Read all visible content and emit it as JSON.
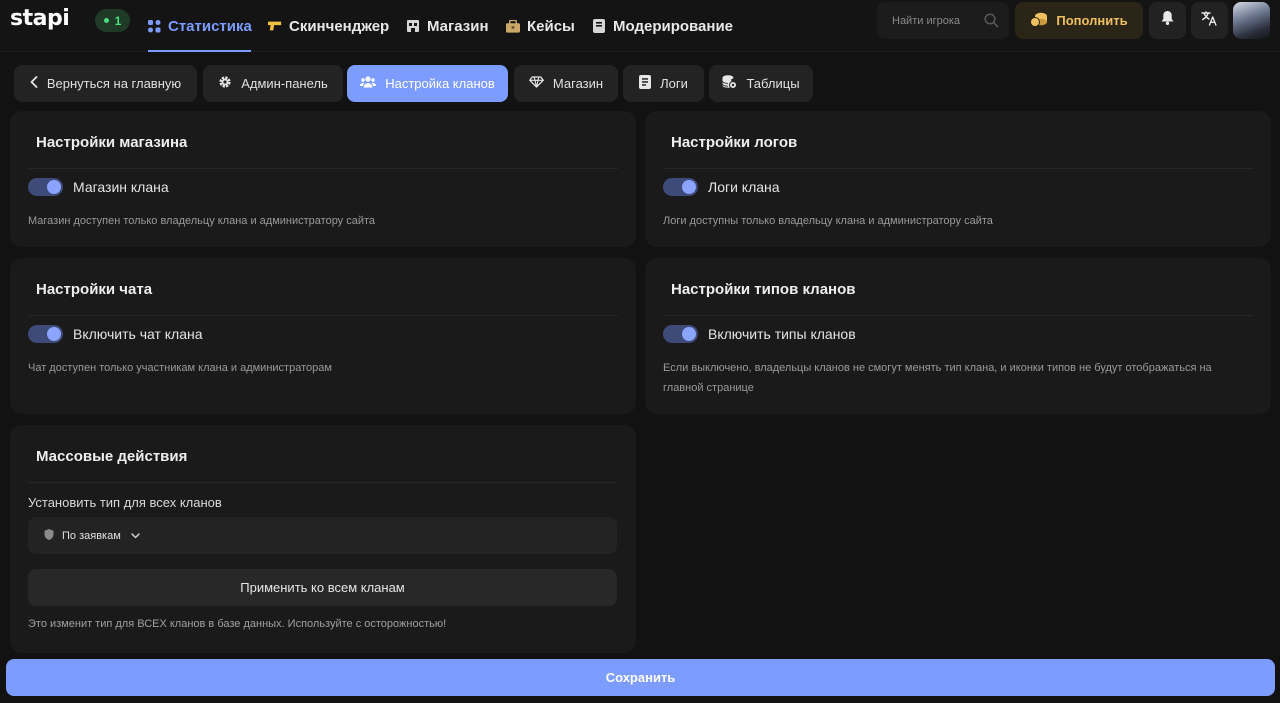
{
  "header": {
    "logo": "stapi",
    "online_count": "1",
    "nav": [
      {
        "label": "Статистика",
        "icon": "stats-icon",
        "active": true
      },
      {
        "label": "Скинченджер",
        "icon": "gun-icon",
        "active": false
      },
      {
        "label": "Магазин",
        "icon": "shop-icon",
        "active": false
      },
      {
        "label": "Кейсы",
        "icon": "case-icon",
        "active": false
      },
      {
        "label": "Модерирование",
        "icon": "book-icon",
        "active": false
      }
    ],
    "search_placeholder": "Найти игрока",
    "topup_label": "Пополнить",
    "colors": {
      "accent": "#7c9cff",
      "topup": "#f0c060",
      "online": "#4ade80"
    }
  },
  "tabs": [
    {
      "label": "Вернуться на главную",
      "icon": "chevron-left-icon",
      "active": false
    },
    {
      "label": "Админ-панель",
      "icon": "gear-icon",
      "active": false
    },
    {
      "label": "Настройка кланов",
      "icon": "users-icon",
      "active": true
    },
    {
      "label": "Магазин",
      "icon": "diamond-icon",
      "active": false
    },
    {
      "label": "Логи",
      "icon": "log-icon",
      "active": false
    },
    {
      "label": "Таблицы",
      "icon": "database-icon",
      "active": false
    }
  ],
  "cards": {
    "shop": {
      "title": "Настройки магазина",
      "toggle_label": "Магазин клана",
      "toggle_on": true,
      "description": "Магазин доступен только владельцу клана и администратору сайта"
    },
    "logs": {
      "title": "Настройки логов",
      "toggle_label": "Логи клана",
      "toggle_on": true,
      "description": "Логи доступны только владельцу клана и администратору сайта"
    },
    "chat": {
      "title": "Настройки чата",
      "toggle_label": "Включить чат клана",
      "toggle_on": true,
      "description": "Чат доступен только участникам клана и администраторам"
    },
    "types": {
      "title": "Настройки типов кланов",
      "toggle_label": "Включить типы кланов",
      "toggle_on": true,
      "description": "Если выключено, владельцы кланов не смогут менять тип клана, и иконки типов не будут отображаться на главной странице"
    },
    "mass": {
      "title": "Массовые действия",
      "field_label": "Установить тип для всех кланов",
      "select_value": "По заявкам",
      "apply_label": "Применить ко всем кланам",
      "warning": "Это изменит тип для ВСЕХ кланов в базе данных. Используйте с осторожностью!"
    }
  },
  "save_label": "Сохранить"
}
